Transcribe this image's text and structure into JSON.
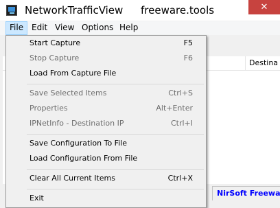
{
  "window": {
    "title": "NetworkTrafficView",
    "title_extra": "freeware.tools",
    "close_glyph": "✕"
  },
  "menubar": {
    "file": "File",
    "edit": "Edit",
    "view": "View",
    "options": "Options",
    "help": "Help"
  },
  "list": {
    "column_destination": "Destina"
  },
  "status": {
    "link_text": "NirSoft Freeware"
  },
  "file_menu": {
    "start_capture": {
      "label": "Start Capture",
      "shortcut": "F5"
    },
    "stop_capture": {
      "label": "Stop Capture",
      "shortcut": "F6"
    },
    "load_capture": {
      "label": "Load From Capture File",
      "shortcut": ""
    },
    "save_selected": {
      "label": "Save Selected Items",
      "shortcut": "Ctrl+S"
    },
    "properties": {
      "label": "Properties",
      "shortcut": "Alt+Enter"
    },
    "ipnetinfo": {
      "label": "IPNetInfo - Destination IP",
      "shortcut": "Ctrl+I"
    },
    "save_config": {
      "label": "Save Configuration To File",
      "shortcut": ""
    },
    "load_config": {
      "label": "Load Configuration From File",
      "shortcut": ""
    },
    "clear_all": {
      "label": "Clear All Current Items",
      "shortcut": "Ctrl+X"
    },
    "exit": {
      "label": "Exit",
      "shortcut": ""
    }
  },
  "colors": {
    "menu_highlight": "#cce8ff",
    "close_button": "#c7433f",
    "link": "#0000ff",
    "disabled_text": "#6d6d6d"
  }
}
